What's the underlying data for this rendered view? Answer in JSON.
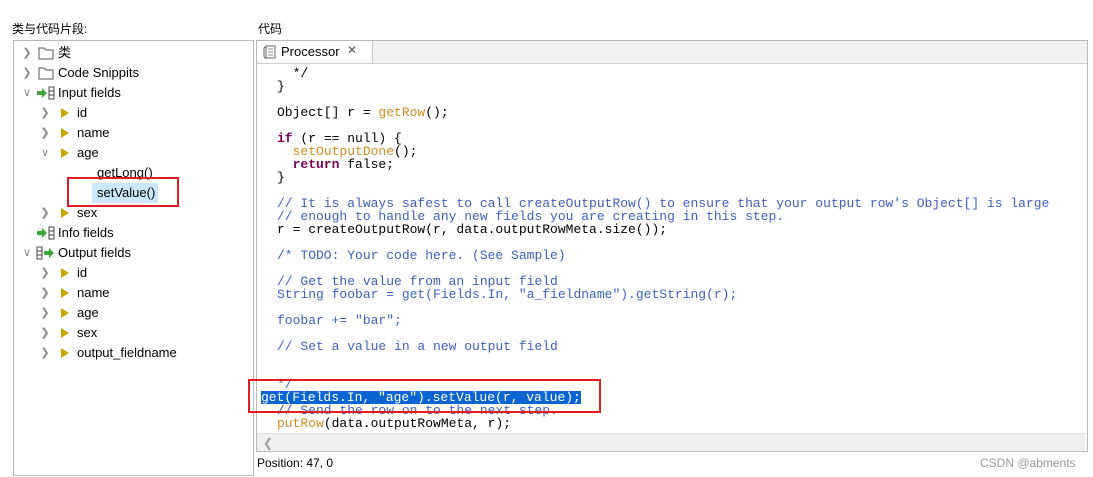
{
  "left_title": "类与代码片段:",
  "right_title": "代码",
  "tree": {
    "class_folder": "类",
    "code_snippits": "Code Snippits",
    "input_fields": "Input fields",
    "input_children": [
      "id",
      "name",
      "age"
    ],
    "age_children": [
      "getLong()",
      "setValue()"
    ],
    "sex": "sex",
    "info_fields": "Info fields",
    "output_fields": "Output fields",
    "output_children": [
      "id",
      "name",
      "age",
      "sex",
      "output_fieldname"
    ]
  },
  "editor": {
    "tab_label": "Processor",
    "tab_close": "✕",
    "lines": {
      "l1": "  */",
      "l2": "}",
      "l3a": "Object[] r = ",
      "l3b": "getRow",
      "l3c": "();",
      "l4a": "if",
      "l4b": " (r == null) {",
      "l5a": "  ",
      "l5b": "setOutputDone",
      "l5c": "();",
      "l6a": "  ",
      "l6b": "return",
      "l6c": " false;",
      "l7": "}",
      "c1": "// It is always safest to call createOutputRow() to ensure that your output row's Object[] is large",
      "c2": "// enough to handle any new fields you are creating in this step.",
      "l8": "r = createOutputRow(r, data.outputRowMeta.size());",
      "c3": "/* TODO: Your code here. (See Sample)",
      "c4": "// Get the value from an input field",
      "l9": "String foobar = get(Fields.In, \"a_fieldname\").getString(r);",
      "l10": "foobar += \"bar\";",
      "c5": "// Set a value in a new output field",
      "c6": "*/",
      "hl": "get(Fields.In, \"age\").setValue(r, value);",
      "c7": "// Send the row on to the next step.",
      "l11a": "putRow",
      "l11b": "(data.outputRowMeta, r);"
    }
  },
  "status_text": "Position: 47, 0",
  "watermark": "CSDN @abments",
  "colors": {
    "keyword": "#7f0055",
    "method": "#d9891b",
    "comment": "#3f5fbf",
    "highlight": "#0a64d2",
    "annotation": "#e02020"
  }
}
